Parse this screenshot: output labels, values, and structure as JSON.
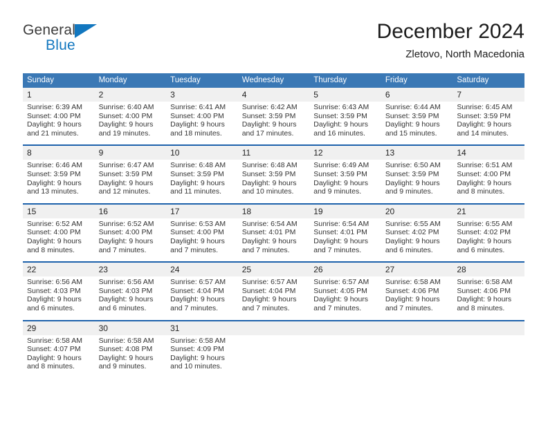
{
  "brand": {
    "name_part1": "General",
    "name_part2": "Blue",
    "flag_icon": "triangle-flag-icon",
    "accent_color": "#1277bf"
  },
  "header": {
    "title": "December 2024",
    "subtitle": "Zletovo, North Macedonia"
  },
  "calendar": {
    "header_color": "#3a78b5",
    "row_divider_color": "#1c61ab",
    "daynum_bg": "#f0f0f0",
    "weekday_headers": [
      "Sunday",
      "Monday",
      "Tuesday",
      "Wednesday",
      "Thursday",
      "Friday",
      "Saturday"
    ],
    "weeks": [
      [
        {
          "day": "1",
          "sunrise": "Sunrise: 6:39 AM",
          "sunset": "Sunset: 4:00 PM",
          "daylight_1": "Daylight: 9 hours",
          "daylight_2": "and 21 minutes."
        },
        {
          "day": "2",
          "sunrise": "Sunrise: 6:40 AM",
          "sunset": "Sunset: 4:00 PM",
          "daylight_1": "Daylight: 9 hours",
          "daylight_2": "and 19 minutes."
        },
        {
          "day": "3",
          "sunrise": "Sunrise: 6:41 AM",
          "sunset": "Sunset: 4:00 PM",
          "daylight_1": "Daylight: 9 hours",
          "daylight_2": "and 18 minutes."
        },
        {
          "day": "4",
          "sunrise": "Sunrise: 6:42 AM",
          "sunset": "Sunset: 3:59 PM",
          "daylight_1": "Daylight: 9 hours",
          "daylight_2": "and 17 minutes."
        },
        {
          "day": "5",
          "sunrise": "Sunrise: 6:43 AM",
          "sunset": "Sunset: 3:59 PM",
          "daylight_1": "Daylight: 9 hours",
          "daylight_2": "and 16 minutes."
        },
        {
          "day": "6",
          "sunrise": "Sunrise: 6:44 AM",
          "sunset": "Sunset: 3:59 PM",
          "daylight_1": "Daylight: 9 hours",
          "daylight_2": "and 15 minutes."
        },
        {
          "day": "7",
          "sunrise": "Sunrise: 6:45 AM",
          "sunset": "Sunset: 3:59 PM",
          "daylight_1": "Daylight: 9 hours",
          "daylight_2": "and 14 minutes."
        }
      ],
      [
        {
          "day": "8",
          "sunrise": "Sunrise: 6:46 AM",
          "sunset": "Sunset: 3:59 PM",
          "daylight_1": "Daylight: 9 hours",
          "daylight_2": "and 13 minutes."
        },
        {
          "day": "9",
          "sunrise": "Sunrise: 6:47 AM",
          "sunset": "Sunset: 3:59 PM",
          "daylight_1": "Daylight: 9 hours",
          "daylight_2": "and 12 minutes."
        },
        {
          "day": "10",
          "sunrise": "Sunrise: 6:48 AM",
          "sunset": "Sunset: 3:59 PM",
          "daylight_1": "Daylight: 9 hours",
          "daylight_2": "and 11 minutes."
        },
        {
          "day": "11",
          "sunrise": "Sunrise: 6:48 AM",
          "sunset": "Sunset: 3:59 PM",
          "daylight_1": "Daylight: 9 hours",
          "daylight_2": "and 10 minutes."
        },
        {
          "day": "12",
          "sunrise": "Sunrise: 6:49 AM",
          "sunset": "Sunset: 3:59 PM",
          "daylight_1": "Daylight: 9 hours",
          "daylight_2": "and 9 minutes."
        },
        {
          "day": "13",
          "sunrise": "Sunrise: 6:50 AM",
          "sunset": "Sunset: 3:59 PM",
          "daylight_1": "Daylight: 9 hours",
          "daylight_2": "and 9 minutes."
        },
        {
          "day": "14",
          "sunrise": "Sunrise: 6:51 AM",
          "sunset": "Sunset: 4:00 PM",
          "daylight_1": "Daylight: 9 hours",
          "daylight_2": "and 8 minutes."
        }
      ],
      [
        {
          "day": "15",
          "sunrise": "Sunrise: 6:52 AM",
          "sunset": "Sunset: 4:00 PM",
          "daylight_1": "Daylight: 9 hours",
          "daylight_2": "and 8 minutes."
        },
        {
          "day": "16",
          "sunrise": "Sunrise: 6:52 AM",
          "sunset": "Sunset: 4:00 PM",
          "daylight_1": "Daylight: 9 hours",
          "daylight_2": "and 7 minutes."
        },
        {
          "day": "17",
          "sunrise": "Sunrise: 6:53 AM",
          "sunset": "Sunset: 4:00 PM",
          "daylight_1": "Daylight: 9 hours",
          "daylight_2": "and 7 minutes."
        },
        {
          "day": "18",
          "sunrise": "Sunrise: 6:54 AM",
          "sunset": "Sunset: 4:01 PM",
          "daylight_1": "Daylight: 9 hours",
          "daylight_2": "and 7 minutes."
        },
        {
          "day": "19",
          "sunrise": "Sunrise: 6:54 AM",
          "sunset": "Sunset: 4:01 PM",
          "daylight_1": "Daylight: 9 hours",
          "daylight_2": "and 7 minutes."
        },
        {
          "day": "20",
          "sunrise": "Sunrise: 6:55 AM",
          "sunset": "Sunset: 4:02 PM",
          "daylight_1": "Daylight: 9 hours",
          "daylight_2": "and 6 minutes."
        },
        {
          "day": "21",
          "sunrise": "Sunrise: 6:55 AM",
          "sunset": "Sunset: 4:02 PM",
          "daylight_1": "Daylight: 9 hours",
          "daylight_2": "and 6 minutes."
        }
      ],
      [
        {
          "day": "22",
          "sunrise": "Sunrise: 6:56 AM",
          "sunset": "Sunset: 4:03 PM",
          "daylight_1": "Daylight: 9 hours",
          "daylight_2": "and 6 minutes."
        },
        {
          "day": "23",
          "sunrise": "Sunrise: 6:56 AM",
          "sunset": "Sunset: 4:03 PM",
          "daylight_1": "Daylight: 9 hours",
          "daylight_2": "and 6 minutes."
        },
        {
          "day": "24",
          "sunrise": "Sunrise: 6:57 AM",
          "sunset": "Sunset: 4:04 PM",
          "daylight_1": "Daylight: 9 hours",
          "daylight_2": "and 7 minutes."
        },
        {
          "day": "25",
          "sunrise": "Sunrise: 6:57 AM",
          "sunset": "Sunset: 4:04 PM",
          "daylight_1": "Daylight: 9 hours",
          "daylight_2": "and 7 minutes."
        },
        {
          "day": "26",
          "sunrise": "Sunrise: 6:57 AM",
          "sunset": "Sunset: 4:05 PM",
          "daylight_1": "Daylight: 9 hours",
          "daylight_2": "and 7 minutes."
        },
        {
          "day": "27",
          "sunrise": "Sunrise: 6:58 AM",
          "sunset": "Sunset: 4:06 PM",
          "daylight_1": "Daylight: 9 hours",
          "daylight_2": "and 7 minutes."
        },
        {
          "day": "28",
          "sunrise": "Sunrise: 6:58 AM",
          "sunset": "Sunset: 4:06 PM",
          "daylight_1": "Daylight: 9 hours",
          "daylight_2": "and 8 minutes."
        }
      ],
      [
        {
          "day": "29",
          "sunrise": "Sunrise: 6:58 AM",
          "sunset": "Sunset: 4:07 PM",
          "daylight_1": "Daylight: 9 hours",
          "daylight_2": "and 8 minutes."
        },
        {
          "day": "30",
          "sunrise": "Sunrise: 6:58 AM",
          "sunset": "Sunset: 4:08 PM",
          "daylight_1": "Daylight: 9 hours",
          "daylight_2": "and 9 minutes."
        },
        {
          "day": "31",
          "sunrise": "Sunrise: 6:58 AM",
          "sunset": "Sunset: 4:09 PM",
          "daylight_1": "Daylight: 9 hours",
          "daylight_2": "and 10 minutes."
        },
        {
          "day": "",
          "sunrise": "",
          "sunset": "",
          "daylight_1": "",
          "daylight_2": ""
        },
        {
          "day": "",
          "sunrise": "",
          "sunset": "",
          "daylight_1": "",
          "daylight_2": ""
        },
        {
          "day": "",
          "sunrise": "",
          "sunset": "",
          "daylight_1": "",
          "daylight_2": ""
        },
        {
          "day": "",
          "sunrise": "",
          "sunset": "",
          "daylight_1": "",
          "daylight_2": ""
        }
      ]
    ]
  }
}
